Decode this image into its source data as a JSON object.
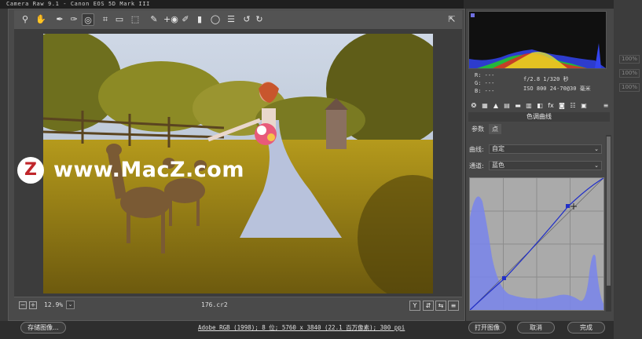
{
  "window": {
    "title": "Camera Raw 9.1  -  Canon EOS 5D Mark III"
  },
  "toolbar": {
    "tools": [
      {
        "name": "zoom-tool-icon",
        "glyph": "⚲"
      },
      {
        "name": "hand-tool-icon",
        "glyph": "✋"
      },
      {
        "name": "white-balance-tool-icon",
        "glyph": "✒"
      },
      {
        "name": "color-sampler-tool-icon",
        "glyph": "✑"
      },
      {
        "name": "targeted-adjustment-tool-icon",
        "glyph": "◎"
      },
      {
        "name": "crop-tool-icon",
        "glyph": "⌗"
      },
      {
        "name": "straighten-tool-icon",
        "glyph": "▭"
      },
      {
        "name": "transform-tool-icon",
        "glyph": "⬚"
      },
      {
        "name": "spot-removal-tool-icon",
        "glyph": "✎"
      },
      {
        "name": "red-eye-tool-icon",
        "glyph": "+◉"
      },
      {
        "name": "adjustment-brush-icon",
        "glyph": "✐"
      },
      {
        "name": "graduated-filter-icon",
        "glyph": "▮"
      },
      {
        "name": "radial-filter-icon",
        "glyph": "◯"
      },
      {
        "name": "preferences-icon",
        "glyph": "☰"
      },
      {
        "name": "rotate-ccw-icon",
        "glyph": "↺"
      },
      {
        "name": "rotate-cw-icon",
        "glyph": "↻"
      }
    ],
    "fullscreen_glyph": "⇱"
  },
  "status": {
    "zoom_out": "−",
    "zoom_in": "+",
    "zoom": "12.9%",
    "zoom_arrow": "⌄",
    "filename": "176.cr2",
    "view_y": "Y",
    "view_b1": "⇵",
    "view_b2": "⇆",
    "view_b3": "≡"
  },
  "watermark": {
    "logo": "Z",
    "text": "www.MacZ.com"
  },
  "bottom": {
    "save_label": "存储图像...",
    "workflow": "Adobe RGB (1998); 8 位; 5760 x 3840 (22.1 百万像素); 300 ppi",
    "open_label": "打开图像",
    "cancel_label": "取消",
    "done_label": "完成"
  },
  "readout": {
    "r": "R:  ---",
    "g": "G:  ---",
    "b": "B:  ---",
    "exposure": "f/2.8   1/320 秒",
    "iso": "ISO 800   24-70@30 毫米"
  },
  "panel": {
    "title": "色调曲线",
    "tabs": [
      "参数",
      "点"
    ],
    "curve_label": "曲线:",
    "curve_value": "自定",
    "channel_label": "通道:",
    "channel_value": "蓝色",
    "icons": [
      {
        "name": "basic-panel-icon",
        "glyph": "❂"
      },
      {
        "name": "tone-curve-panel-icon",
        "glyph": "▦"
      },
      {
        "name": "detail-panel-icon",
        "glyph": "▲"
      },
      {
        "name": "hsl-panel-icon",
        "glyph": "▤"
      },
      {
        "name": "split-toning-panel-icon",
        "glyph": "▬"
      },
      {
        "name": "lens-panel-icon",
        "glyph": "▥"
      },
      {
        "name": "effects-panel-icon",
        "glyph": "◧"
      },
      {
        "name": "fx-panel-icon",
        "glyph": "fx"
      },
      {
        "name": "camera-calibration-icon",
        "glyph": "◙"
      },
      {
        "name": "presets-panel-icon",
        "glyph": "☷"
      },
      {
        "name": "snapshots-panel-icon",
        "glyph": "▣"
      }
    ],
    "menu_glyph": "≡"
  },
  "side": {
    "pct1": "100%",
    "pct2": "100%",
    "pct3": "100%"
  },
  "colors": {
    "accent_blue": "#6b7fe6",
    "curve_line": "#2230c8",
    "histo_bg": "#101010"
  }
}
